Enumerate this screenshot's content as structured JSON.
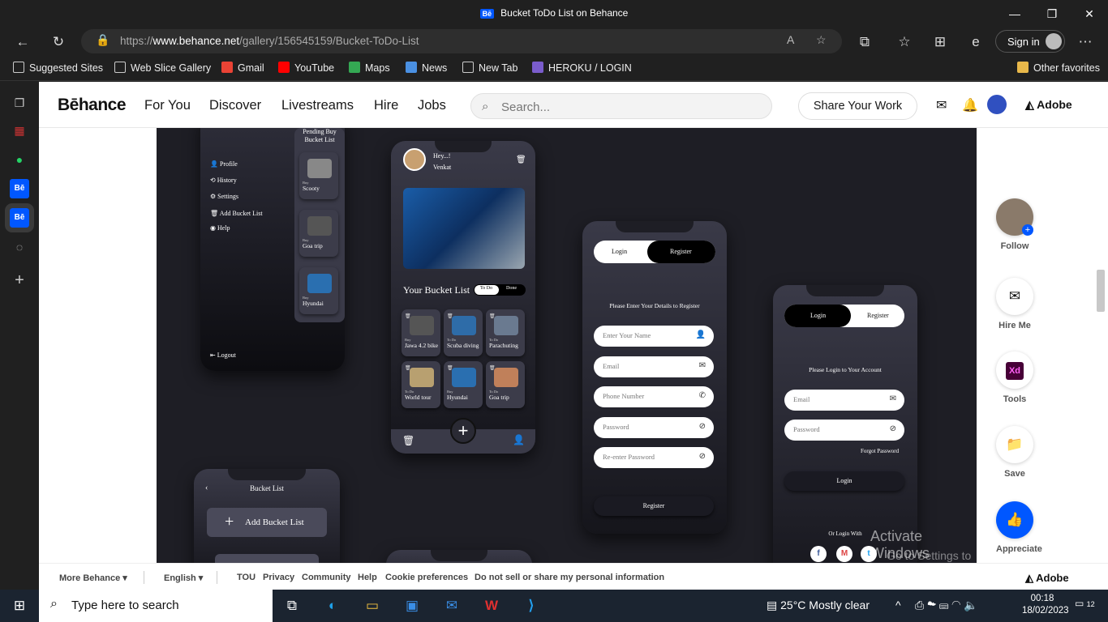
{
  "window": {
    "title": "Bucket ToDo List on Behance",
    "be_badge": "Bē"
  },
  "browser": {
    "url_prefix": "https://",
    "url_domain": "www.behance.net",
    "url_path": "/gallery/156545159/Bucket-ToDo-List",
    "signin_label": "Sign in"
  },
  "favorites": [
    {
      "label": "Suggested Sites",
      "color": "#cccccc"
    },
    {
      "label": "Web Slice Gallery",
      "color": "#cccccc"
    },
    {
      "label": "Gmail",
      "color": "#ea4335"
    },
    {
      "label": "YouTube",
      "color": "#ff0000"
    },
    {
      "label": "Maps",
      "color": "#34a853"
    },
    {
      "label": "News",
      "color": "#4a90e2"
    },
    {
      "label": "New Tab",
      "color": "#cccccc"
    },
    {
      "label": "HEROKU / LOGIN",
      "color": "#7a5ccc"
    }
  ],
  "favorites_other": "Other favorites",
  "behance": {
    "logo": "Bēhance",
    "nav": [
      "For You",
      "Discover",
      "Livestreams",
      "Hire",
      "Jobs"
    ],
    "search_placeholder": "Search...",
    "share_label": "Share Your Work",
    "adobe_label": "Adobe"
  },
  "right_panel": {
    "follow": "Follow",
    "hire_me": "Hire Me",
    "tools": "Tools",
    "tools_badge": "Xd",
    "save": "Save",
    "appreciate": "Appreciate"
  },
  "mockup": {
    "menu": {
      "items": [
        "Profile",
        "History",
        "Settings",
        "Add Bucket List",
        "Help"
      ],
      "logout": "Logout",
      "pending_title": "Pending Buy Bucket List",
      "pending": [
        {
          "tag": "Buy",
          "label": "Scooty"
        },
        {
          "tag": "Buy",
          "label": "Goa trip"
        },
        {
          "tag": "Buy",
          "label": "Hyundai"
        }
      ]
    },
    "home": {
      "greeting": "Hey...!",
      "name": "Venkat",
      "section_title": "Your Bucket List",
      "toggle_todo": "To Do",
      "toggle_done": "Done",
      "cards": [
        {
          "tag": "Buy",
          "label": "Jawa 4.2 bike"
        },
        {
          "tag": "To Do",
          "label": "Scuba diving"
        },
        {
          "tag": "To Do",
          "label": "Parachuting"
        },
        {
          "tag": "To Do",
          "label": "World tour"
        },
        {
          "tag": "Buy",
          "label": "Hyundai"
        },
        {
          "tag": "To Do",
          "label": "Goa trip"
        }
      ]
    },
    "register": {
      "tab_login": "Login",
      "tab_register": "Register",
      "prompt": "Please Enter Your Details to Register",
      "fields": [
        "Enter Your Name",
        "Email",
        "Phone Number",
        "Password",
        "Re-enter Password"
      ],
      "button": "Register"
    },
    "login": {
      "tab_login": "Login",
      "tab_register": "Register",
      "prompt": "Please Login to Your Account",
      "fields": [
        "Email",
        "Password"
      ],
      "forgot": "Forgot Password",
      "button": "Login",
      "or_login": "Or Login With"
    },
    "add": {
      "title": "Bucket List",
      "button": "Add Bucket List"
    }
  },
  "footer": {
    "more": "More Behance",
    "language": "English",
    "links": [
      "TOU",
      "Privacy",
      "Community",
      "Help",
      "Cookie preferences",
      "Do not sell or share my personal information"
    ],
    "adobe": "Adobe"
  },
  "watermark": {
    "line1": "Activate Windows",
    "line2": "Go to Settings to activate Windows."
  },
  "taskbar": {
    "search_placeholder": "Type here to search",
    "weather": "25°C  Mostly clear",
    "time": "00:18",
    "date": "18/02/2023",
    "notifications": "12"
  }
}
